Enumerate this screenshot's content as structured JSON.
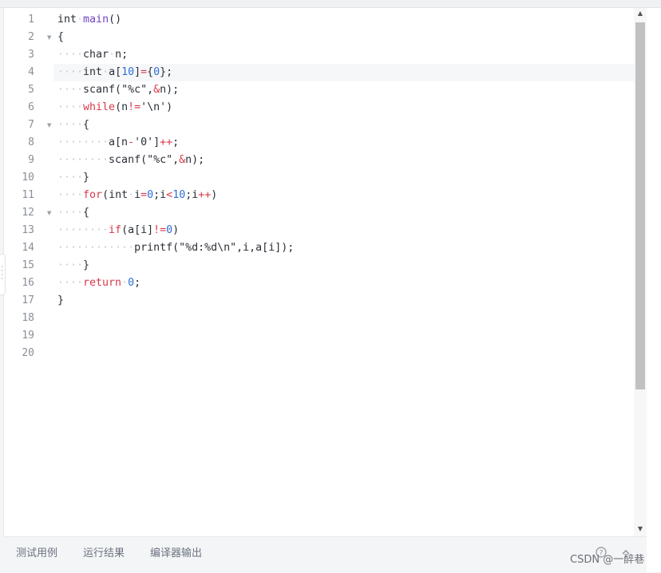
{
  "editor": {
    "line_numbers": [
      "1",
      "2",
      "3",
      "4",
      "5",
      "6",
      "7",
      "8",
      "9",
      "10",
      "11",
      "12",
      "13",
      "14",
      "15",
      "16",
      "17",
      "18",
      "19",
      "20"
    ],
    "fold_marker": "▼",
    "code_lines": [
      "int main()",
      "{",
      "char n;",
      "int a[10]={0};",
      "scanf(\"%c\",&n);",
      "while(n!='\\n')",
      "{",
      "a[n-'0']++;",
      "scanf(\"%c\",&n);",
      "}",
      "for(int i=0;i<10;i++)",
      "{",
      "if(a[i]!=0)",
      "printf(\"%d:%d\\n\",i,a[i]);",
      "}",
      "return 0;",
      "}",
      "",
      "",
      ""
    ]
  },
  "bottom_tabs": {
    "test_cases": "测试用例",
    "run_result": "运行结果",
    "compiler_output": "编译器输出"
  },
  "icons": {
    "help": "help-circle-icon",
    "collapse": "chevron-up-icon",
    "scroll_up": "triangle-up-icon",
    "scroll_down": "triangle-down-icon",
    "drag_handle": "drag-handle-icon"
  },
  "watermark": "CSDN @一醉巷"
}
